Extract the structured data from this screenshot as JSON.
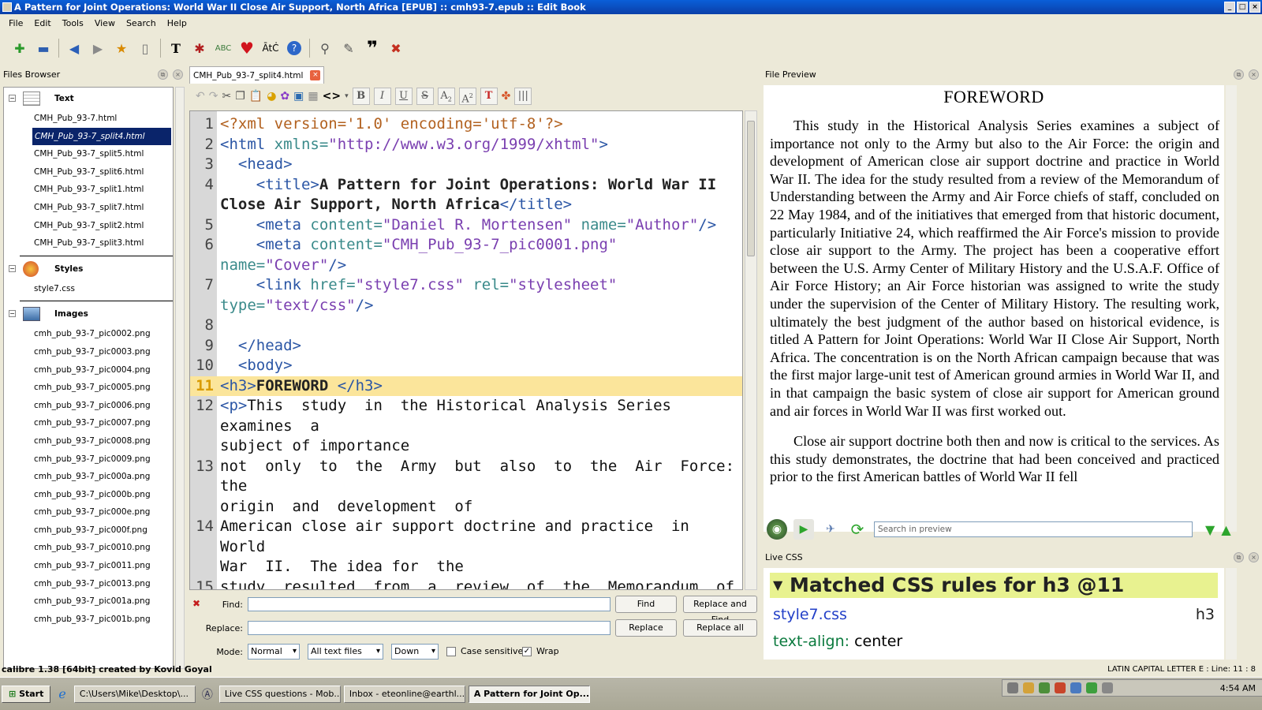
{
  "window": {
    "title": "A Pattern for Joint Operations: World War II Close Air Support, North Africa [EPUB] :: cmh93-7.epub :: Edit Book"
  },
  "menu": [
    "File",
    "Edit",
    "Tools",
    "View",
    "Search",
    "Help"
  ],
  "files_browser": {
    "title": "Files Browser",
    "groups": {
      "text": {
        "label": "Text",
        "items": [
          "CMH_Pub_93-7.html",
          "CMH_Pub_93-7_split4.html",
          "CMH_Pub_93-7_split5.html",
          "CMH_Pub_93-7_split6.html",
          "CMH_Pub_93-7_split1.html",
          "CMH_Pub_93-7_split7.html",
          "CMH_Pub_93-7_split2.html",
          "CMH_Pub_93-7_split3.html"
        ],
        "selected": "CMH_Pub_93-7_split4.html"
      },
      "styles": {
        "label": "Styles",
        "items": [
          "style7.css"
        ]
      },
      "images": {
        "label": "Images",
        "items": [
          "cmh_pub_93-7_pic0002.png",
          "cmh_pub_93-7_pic0003.png",
          "cmh_pub_93-7_pic0004.png",
          "cmh_pub_93-7_pic0005.png",
          "cmh_pub_93-7_pic0006.png",
          "cmh_pub_93-7_pic0007.png",
          "cmh_pub_93-7_pic0008.png",
          "cmh_pub_93-7_pic0009.png",
          "cmh_pub_93-7_pic000a.png",
          "cmh_pub_93-7_pic000b.png",
          "cmh_pub_93-7_pic000e.png",
          "cmh_pub_93-7_pic000f.png",
          "cmh_pub_93-7_pic0010.png",
          "cmh_pub_93-7_pic0011.png",
          "cmh_pub_93-7_pic0013.png",
          "cmh_pub_93-7_pic001a.png",
          "cmh_pub_93-7_pic001b.png"
        ]
      }
    }
  },
  "editor": {
    "tab_label": "CMH_Pub_93-7_split4.html",
    "current_line": 11,
    "lines": [
      {
        "n": "1",
        "tokens": [
          [
            "pi",
            "<?xml version='1.0' encoding='utf-8'?>"
          ]
        ]
      },
      {
        "n": "2",
        "tokens": [
          [
            "tag",
            "<html "
          ],
          [
            "attr",
            "xmlns="
          ],
          [
            "val",
            "\"http://www.w3.org/1999/xhtml\""
          ],
          [
            "tag",
            ">"
          ]
        ]
      },
      {
        "n": "3",
        "tokens": [
          [
            "txt",
            "  "
          ],
          [
            "tag",
            "<head>"
          ]
        ]
      },
      {
        "n": "4",
        "tokens": [
          [
            "txt",
            "    "
          ],
          [
            "tag",
            "<title>"
          ],
          [
            "bold",
            "A Pattern for Joint Operations: World War II"
          ]
        ]
      },
      {
        "n": "",
        "tokens": [
          [
            "bold",
            "Close Air Support, North Africa"
          ],
          [
            "tag",
            "</title>"
          ]
        ]
      },
      {
        "n": "5",
        "tokens": [
          [
            "txt",
            "    "
          ],
          [
            "tag",
            "<meta "
          ],
          [
            "attr",
            "content="
          ],
          [
            "val",
            "\"Daniel R. Mortensen\""
          ],
          [
            "attr",
            " name="
          ],
          [
            "val",
            "\"Author\""
          ],
          [
            "tag",
            "/>"
          ]
        ]
      },
      {
        "n": "6",
        "tokens": [
          [
            "txt",
            "    "
          ],
          [
            "tag",
            "<meta "
          ],
          [
            "attr",
            "content="
          ],
          [
            "val",
            "\"CMH_Pub_93-7_pic0001.png\""
          ]
        ]
      },
      {
        "n": "",
        "tokens": [
          [
            "attr",
            "name="
          ],
          [
            "val",
            "\"Cover\""
          ],
          [
            "tag",
            "/>"
          ]
        ]
      },
      {
        "n": "7",
        "tokens": [
          [
            "txt",
            "    "
          ],
          [
            "tag",
            "<link "
          ],
          [
            "attr",
            "href="
          ],
          [
            "val",
            "\"style7.css\""
          ],
          [
            "attr",
            " rel="
          ],
          [
            "val",
            "\"stylesheet\""
          ],
          [
            "attr",
            " type="
          ],
          [
            "val",
            "\"text/css\""
          ],
          [
            "tag",
            "/>"
          ]
        ]
      },
      {
        "n": "8",
        "tokens": []
      },
      {
        "n": "9",
        "tokens": [
          [
            "txt",
            "  "
          ],
          [
            "tag",
            "</head>"
          ]
        ]
      },
      {
        "n": "10",
        "tokens": [
          [
            "txt",
            "  "
          ],
          [
            "tag",
            "<body>"
          ]
        ]
      },
      {
        "n": "11",
        "tokens": [
          [
            "tag",
            "<h3>"
          ],
          [
            "bold",
            "FOREWORD "
          ],
          [
            "tag",
            "</h3>"
          ]
        ]
      },
      {
        "n": "12",
        "tokens": [
          [
            "tag",
            "<p>"
          ],
          [
            "txt",
            "This  study  in  the Historical Analysis Series examines  a"
          ]
        ]
      },
      {
        "n": "",
        "tokens": [
          [
            "txt",
            "subject of importance"
          ]
        ]
      },
      {
        "n": "13",
        "tokens": [
          [
            "txt",
            "not  only  to  the  Army  but  also  to  the  Air  Force:  the"
          ]
        ]
      },
      {
        "n": "",
        "tokens": [
          [
            "txt",
            "origin  and  development  of"
          ]
        ]
      },
      {
        "n": "14",
        "tokens": [
          [
            "txt",
            "American close air support doctrine and practice  in  World"
          ]
        ]
      },
      {
        "n": "",
        "tokens": [
          [
            "txt",
            "War  II.  The idea for  the"
          ]
        ]
      },
      {
        "n": "15",
        "tokens": [
          [
            "txt",
            "study  resulted  from  a  review  of  the  Memorandum  of"
          ]
        ]
      },
      {
        "n": "",
        "tokens": [
          [
            "txt",
            "Understanding  between  the"
          ]
        ]
      },
      {
        "n": "16",
        "tokens": [
          [
            "txt",
            "Army  and  Air  Force  chiefs  of  staff,  concluded  on  22  May"
          ]
        ]
      },
      {
        "n": "",
        "tokens": [
          [
            "txt",
            "1984,  and  of  the"
          ]
        ]
      },
      {
        "n": "17",
        "tokens": [
          [
            "txt",
            "initiatives  that  emerged  from  that  historic  document"
          ]
        ]
      }
    ]
  },
  "find_replace": {
    "find_label": "Find:",
    "replace_label": "Replace:",
    "mode_label": "Mode:",
    "find_value": "",
    "replace_value": "",
    "find_button": "Find",
    "replace_find_button": "Replace and Find",
    "replace_button": "Replace",
    "replace_all_button": "Replace all",
    "mode": "Normal",
    "scope": "All text files",
    "direction": "Down",
    "case_sensitive_label": "Case sensitive",
    "case_sensitive": false,
    "wrap_label": "Wrap",
    "wrap": true
  },
  "preview": {
    "title": "File Preview",
    "heading": "FOREWORD",
    "paragraphs": [
      "This study in the Historical Analysis Series examines a subject of importance not only to the Army but also to the Air Force: the origin and development of American close air support doctrine and practice in World War II. The idea for the study resulted from a review of the Memorandum of Understanding between the Army and Air Force chiefs of staff, concluded on 22 May 1984, and of the initiatives that emerged from that historic document, particularly Initiative 24, which reaffirmed the Air Force's mission to provide close air support to the Army. The project has been a cooperative effort between the U.S. Army Center of Military History and the U.S.A.F. Office of Air Force History; an Air Force historian was assigned to write the study under the supervision of the Center of Military History. The resulting work, ultimately the best judgment of the author based on historical evidence, is titled A Pattern for Joint Operations: World War II Close Air Support, North Africa. The concentration is on the North African campaign because that was the first major large-unit test of American ground armies in World War II, and in that campaign the basic system of close air support for American ground and air forces in World War II was first worked out.",
      "Close air support doctrine both then and now is critical to the services. As this study demonstrates, the doctrine that had been conceived and practiced prior to the first American battles of World War II fell"
    ],
    "search_placeholder": "Search in preview"
  },
  "live_css": {
    "title": "Live CSS",
    "header": "Matched CSS rules for h3 @11",
    "sheet": "style7.css",
    "selector": "h3",
    "property": "text-align:",
    "value": "center"
  },
  "status": {
    "left": "calibre 1.38 [64bit] created by Kovid Goyal",
    "right": "LATIN CAPITAL LETTER E : Line: 11 : 8"
  },
  "taskbar": {
    "start": "Start",
    "tasks": [
      "C:\\Users\\Mike\\Desktop\\...",
      "Live CSS questions - Mob...",
      "Inbox - eteonline@earthl...",
      "A Pattern for Joint Op..."
    ],
    "active_task": "A Pattern for Joint Op...",
    "clock": "4:54 AM"
  }
}
